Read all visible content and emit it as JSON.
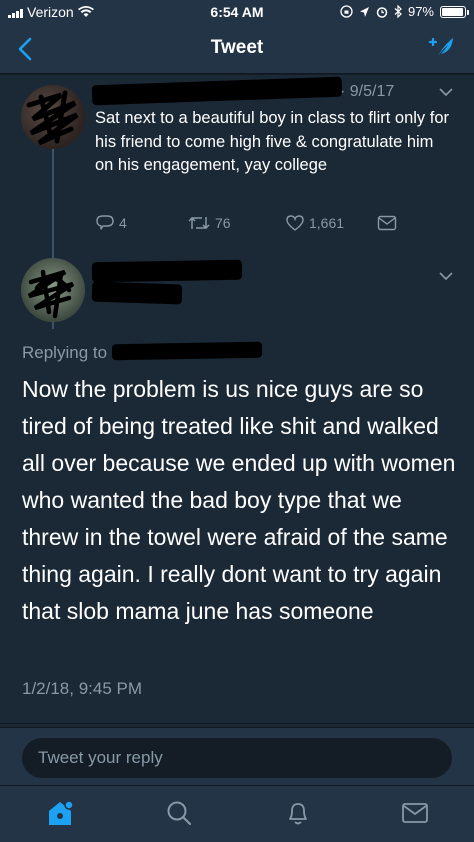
{
  "status_bar": {
    "carrier": "Verizon",
    "time": "6:54 AM",
    "battery": "97%",
    "battery_level": 0.97
  },
  "nav": {
    "title": "Tweet",
    "back_icon": "chevron-left-icon",
    "compose_icon": "compose-tweet-icon"
  },
  "parent_tweet": {
    "date": "· 9/5/17",
    "text": "Sat next to a beautiful boy in class to flirt only for his friend to come high five & congratulate him on his engagement, yay college",
    "replies": "4",
    "retweets": "76",
    "likes": "1,661"
  },
  "main_tweet": {
    "replying_prefix": "Replying to",
    "text": "Now the problem is us nice guys are so tired of being treated like shit and walked all over because we ended up with women who wanted the bad boy type that we threw in the towel were afraid of the same thing again. I really dont want to try again that slob mama june has someone",
    "timestamp": "1/2/18, 9:45 PM"
  },
  "reply_bar": {
    "placeholder": "Tweet your reply"
  },
  "tabs": [
    {
      "name": "home",
      "icon": "home-icon"
    },
    {
      "name": "search",
      "icon": "search-icon"
    },
    {
      "name": "notifications",
      "icon": "bell-icon"
    },
    {
      "name": "messages",
      "icon": "mail-icon"
    }
  ],
  "colors": {
    "background": "#1b2836",
    "bar": "#243447",
    "accent": "#1da1f2",
    "muted": "#8899a6"
  }
}
